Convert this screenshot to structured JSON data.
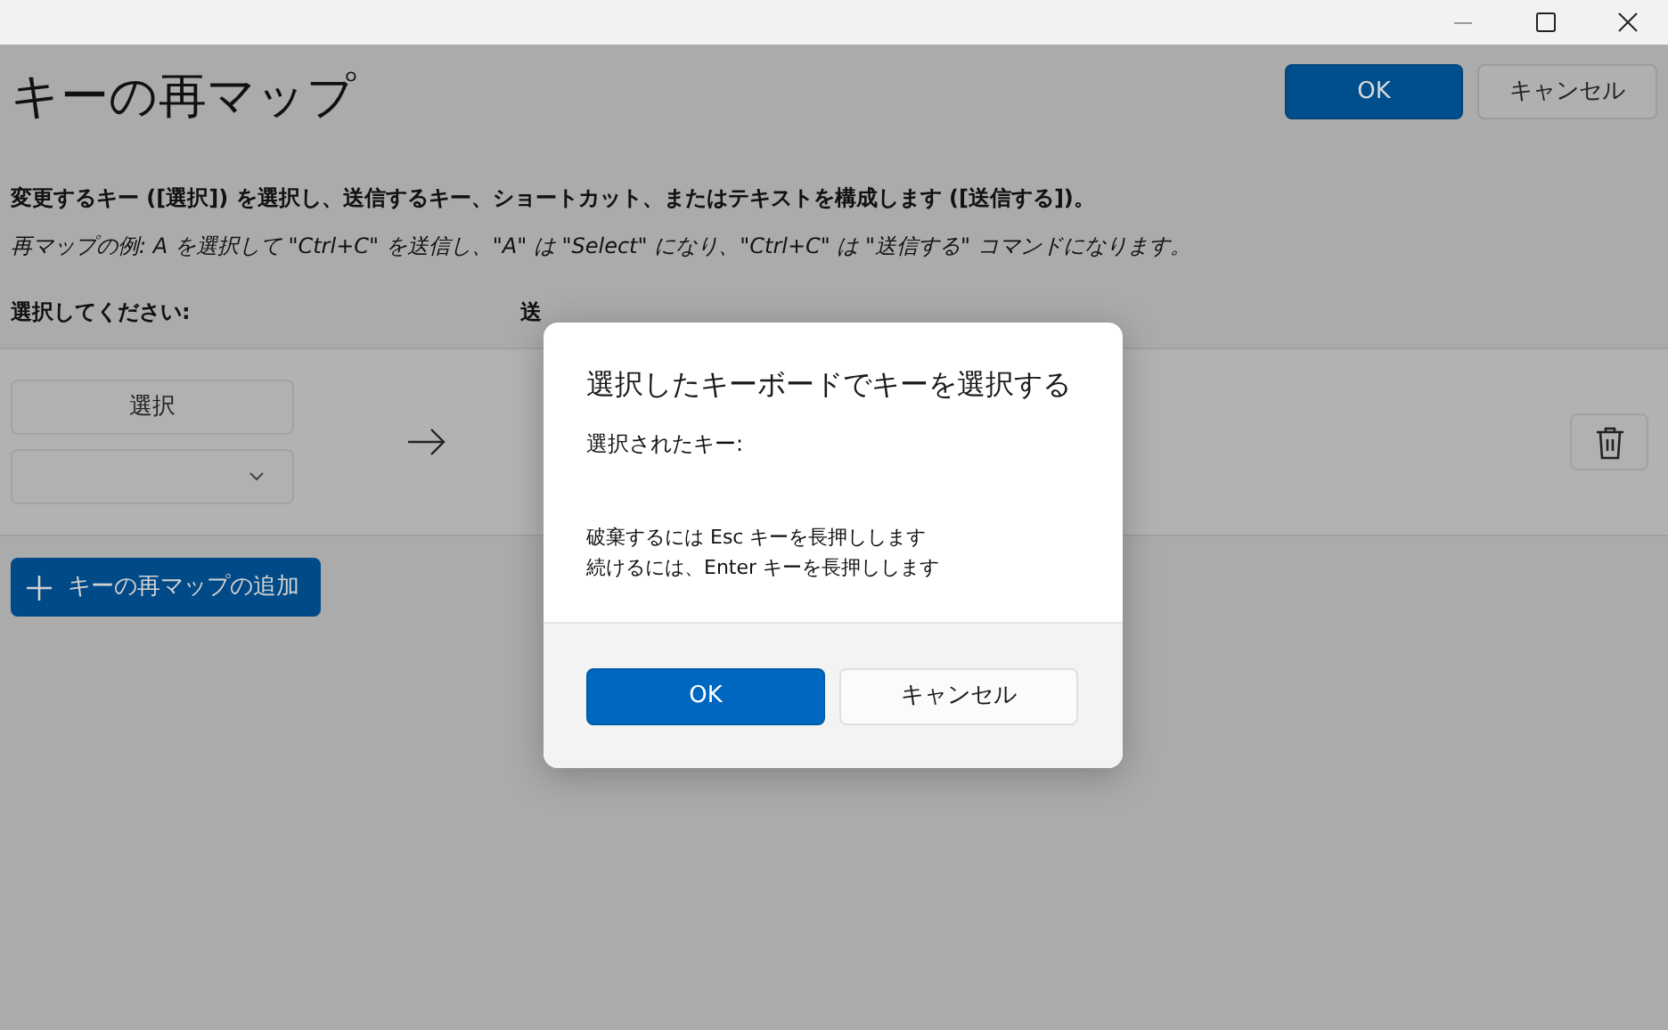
{
  "header": {
    "title": "キーの再マップ",
    "buttons": [
      {
        "label": "OK",
        "kind": "primary"
      },
      {
        "label": "キャンセル",
        "kind": "secondary"
      }
    ]
  },
  "description": "変更するキー ([選択]) を選択し、送信するキー、ショートカット、またはテキストを構成します ([送信する])。",
  "example": "再マップの例: A を選択して \"Ctrl+C\" を送信し、\"A\" は \"Select\" になり、\"Ctrl+C\" は \"送信する\" コマンドになります。",
  "columns": [
    "選択してください:",
    "送"
  ],
  "mappings": [
    {
      "select_button": "選択"
    }
  ],
  "add_button": "キーの再マップの追加",
  "dialog": {
    "title": "選択したキーボードでキーを選択する",
    "selected_key_label": "選択されたキー:",
    "instructions": [
      "破棄するには Esc キーを長押しします",
      "続けるには、Enter キーを長押しします"
    ],
    "buttons": [
      {
        "label": "OK",
        "kind": "primary"
      },
      {
        "label": "キャンセル",
        "kind": "secondary"
      }
    ]
  }
}
